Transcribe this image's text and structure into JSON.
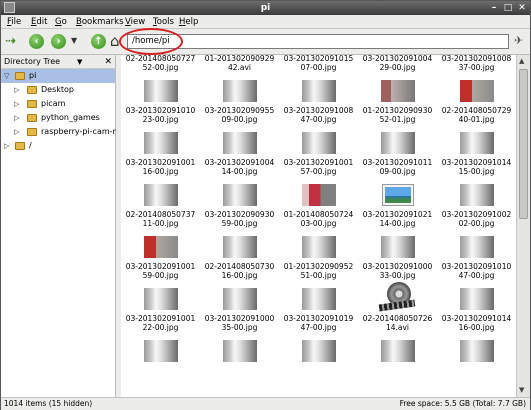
{
  "window": {
    "title": "pi"
  },
  "menu": [
    "File",
    "Edit",
    "Go",
    "Bookmarks",
    "View",
    "Tools",
    "Help"
  ],
  "toolbar": {
    "path": "/home/pi"
  },
  "sidebar": {
    "header": "Directory Tree",
    "items": [
      {
        "label": "pi",
        "level": 0,
        "expanded": true,
        "selected": true
      },
      {
        "label": "Desktop",
        "level": 1
      },
      {
        "label": "picam",
        "level": 1
      },
      {
        "label": "python_games",
        "level": 1
      },
      {
        "label": "raspberry-pi-cam-m",
        "level": 1
      },
      {
        "label": "/",
        "level": 0
      }
    ]
  },
  "files": [
    {
      "l1": "02-201408050727",
      "l2": "52-00.jpg",
      "thumb": "dark"
    },
    {
      "l1": "01-201302090929",
      "l2": "42.avi",
      "thumb": "film"
    },
    {
      "l1": "03-201302091015",
      "l2": "07-00.jpg",
      "thumb": "dark"
    },
    {
      "l1": "03-201302091004",
      "l2": "29-00.jpg",
      "thumb": "dark"
    },
    {
      "l1": "03-201302091008",
      "l2": "37-00.jpg",
      "thumb": "dark"
    },
    {
      "l1": "03-201302091010",
      "l2": "23-00.jpg",
      "thumb": "dark"
    },
    {
      "l1": "03-201302090955",
      "l2": "09-00.jpg",
      "thumb": "dark"
    },
    {
      "l1": "03-201302091008",
      "l2": "47-00.jpg",
      "thumb": "dark"
    },
    {
      "l1": "01-201302090930",
      "l2": "52-01.jpg",
      "thumb": "reddish"
    },
    {
      "l1": "02-201408050729",
      "l2": "40-01.jpg",
      "thumb": "red"
    },
    {
      "l1": "03-201302091001",
      "l2": "16-00.jpg",
      "thumb": "dark"
    },
    {
      "l1": "03-201302091004",
      "l2": "14-00.jpg",
      "thumb": "dark"
    },
    {
      "l1": "03-201302091001",
      "l2": "57-00.jpg",
      "thumb": "dark"
    },
    {
      "l1": "03-201302091011",
      "l2": "09-00.jpg",
      "thumb": "dark"
    },
    {
      "l1": "03-201302091014",
      "l2": "15-00.jpg",
      "thumb": "dark"
    },
    {
      "l1": "02-201408050737",
      "l2": "11-00.jpg",
      "thumb": "dark"
    },
    {
      "l1": "03-201302090930",
      "l2": "59-00.jpg",
      "thumb": "dark"
    },
    {
      "l1": "01-201408050724",
      "l2": "03-00.jpg",
      "thumb": "pink"
    },
    {
      "l1": "03-201302091021",
      "l2": "14-00.jpg",
      "thumb": "landscape"
    },
    {
      "l1": "03-201302091002",
      "l2": "02-00.jpg",
      "thumb": "dark"
    },
    {
      "l1": "03-201302091001",
      "l2": "59-00.jpg",
      "thumb": "red"
    },
    {
      "l1": "02-201408050730",
      "l2": "16-00.jpg",
      "thumb": "dark"
    },
    {
      "l1": "01-201302090952",
      "l2": "51-00.jpg",
      "thumb": "dark"
    },
    {
      "l1": "03-201302091000",
      "l2": "33-00.jpg",
      "thumb": "dark"
    },
    {
      "l1": "03-201302091010",
      "l2": "47-00.jpg",
      "thumb": "dark"
    },
    {
      "l1": "03-201302091001",
      "l2": "22-00.jpg",
      "thumb": "dark"
    },
    {
      "l1": "03-201302091000",
      "l2": "35-00.jpg",
      "thumb": "dark"
    },
    {
      "l1": "03-201302091019",
      "l2": "47-00.jpg",
      "thumb": "dark"
    },
    {
      "l1": "02-201408050726",
      "l2": "14.avi",
      "thumb": "film"
    },
    {
      "l1": "03-201302091014",
      "l2": "16-00.jpg",
      "thumb": "dark"
    },
    {
      "l1": "",
      "l2": "",
      "thumb": "dark"
    },
    {
      "l1": "",
      "l2": "",
      "thumb": "dark"
    },
    {
      "l1": "",
      "l2": "",
      "thumb": "dark"
    },
    {
      "l1": "",
      "l2": "",
      "thumb": "dark"
    },
    {
      "l1": "",
      "l2": "",
      "thumb": "dark"
    }
  ],
  "status": {
    "left": "1014 items (15 hidden)",
    "right": "Free space: 5.5 GB (Total: 7.7 GB)"
  }
}
